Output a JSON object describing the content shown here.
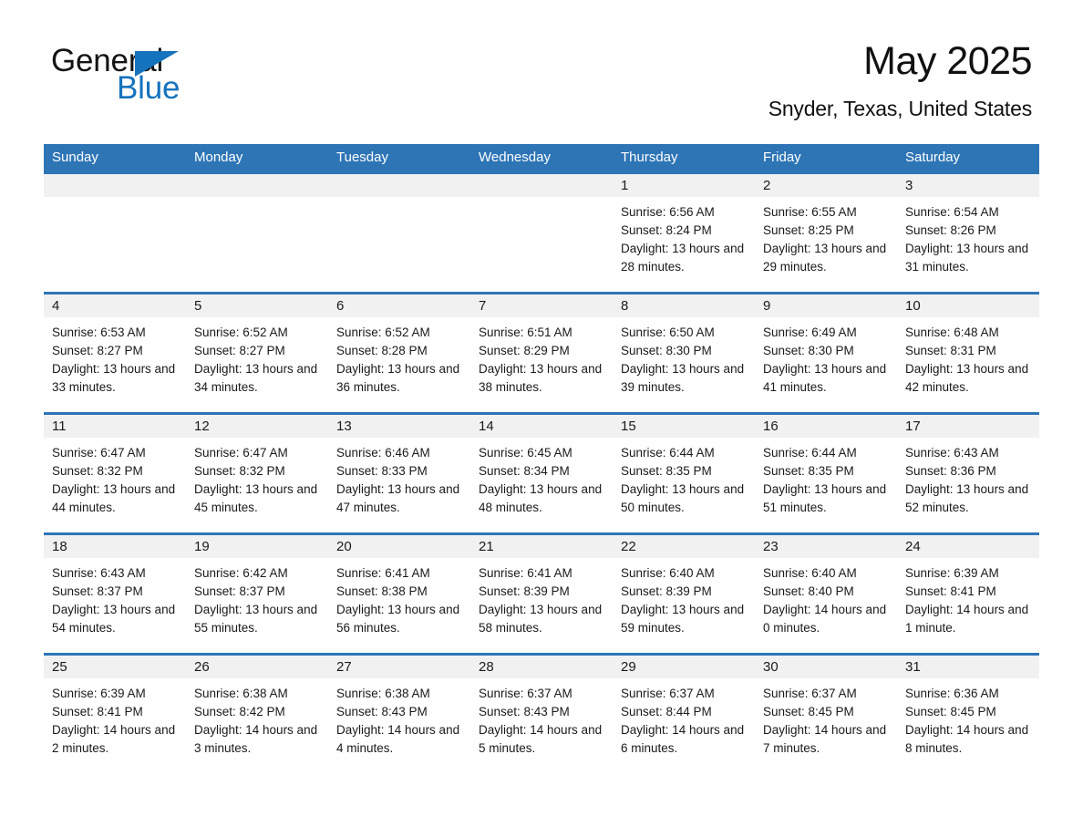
{
  "brand": {
    "name_part1": "General",
    "name_part2": "Blue",
    "triangle_color": "#1573bd",
    "logo_icon": "general-blue-triangle-logo"
  },
  "header": {
    "title": "May 2025",
    "subtitle": "Snyder, Texas, United States"
  },
  "colors": {
    "header_blue": "#2e75b6",
    "row_divider_blue": "#2e75b6",
    "daynum_band": "#f1f1f1",
    "text": "#1a1a1a",
    "page_background": "#ffffff"
  },
  "calendar": {
    "weekday_headers": [
      "Sunday",
      "Monday",
      "Tuesday",
      "Wednesday",
      "Thursday",
      "Friday",
      "Saturday"
    ],
    "weeks": [
      [
        {
          "day": "",
          "sunrise": "",
          "sunset": "",
          "daylight": ""
        },
        {
          "day": "",
          "sunrise": "",
          "sunset": "",
          "daylight": ""
        },
        {
          "day": "",
          "sunrise": "",
          "sunset": "",
          "daylight": ""
        },
        {
          "day": "",
          "sunrise": "",
          "sunset": "",
          "daylight": ""
        },
        {
          "day": "1",
          "sunrise": "Sunrise: 6:56 AM",
          "sunset": "Sunset: 8:24 PM",
          "daylight": "Daylight: 13 hours and 28 minutes."
        },
        {
          "day": "2",
          "sunrise": "Sunrise: 6:55 AM",
          "sunset": "Sunset: 8:25 PM",
          "daylight": "Daylight: 13 hours and 29 minutes."
        },
        {
          "day": "3",
          "sunrise": "Sunrise: 6:54 AM",
          "sunset": "Sunset: 8:26 PM",
          "daylight": "Daylight: 13 hours and 31 minutes."
        }
      ],
      [
        {
          "day": "4",
          "sunrise": "Sunrise: 6:53 AM",
          "sunset": "Sunset: 8:27 PM",
          "daylight": "Daylight: 13 hours and 33 minutes."
        },
        {
          "day": "5",
          "sunrise": "Sunrise: 6:52 AM",
          "sunset": "Sunset: 8:27 PM",
          "daylight": "Daylight: 13 hours and 34 minutes."
        },
        {
          "day": "6",
          "sunrise": "Sunrise: 6:52 AM",
          "sunset": "Sunset: 8:28 PM",
          "daylight": "Daylight: 13 hours and 36 minutes."
        },
        {
          "day": "7",
          "sunrise": "Sunrise: 6:51 AM",
          "sunset": "Sunset: 8:29 PM",
          "daylight": "Daylight: 13 hours and 38 minutes."
        },
        {
          "day": "8",
          "sunrise": "Sunrise: 6:50 AM",
          "sunset": "Sunset: 8:30 PM",
          "daylight": "Daylight: 13 hours and 39 minutes."
        },
        {
          "day": "9",
          "sunrise": "Sunrise: 6:49 AM",
          "sunset": "Sunset: 8:30 PM",
          "daylight": "Daylight: 13 hours and 41 minutes."
        },
        {
          "day": "10",
          "sunrise": "Sunrise: 6:48 AM",
          "sunset": "Sunset: 8:31 PM",
          "daylight": "Daylight: 13 hours and 42 minutes."
        }
      ],
      [
        {
          "day": "11",
          "sunrise": "Sunrise: 6:47 AM",
          "sunset": "Sunset: 8:32 PM",
          "daylight": "Daylight: 13 hours and 44 minutes."
        },
        {
          "day": "12",
          "sunrise": "Sunrise: 6:47 AM",
          "sunset": "Sunset: 8:32 PM",
          "daylight": "Daylight: 13 hours and 45 minutes."
        },
        {
          "day": "13",
          "sunrise": "Sunrise: 6:46 AM",
          "sunset": "Sunset: 8:33 PM",
          "daylight": "Daylight: 13 hours and 47 minutes."
        },
        {
          "day": "14",
          "sunrise": "Sunrise: 6:45 AM",
          "sunset": "Sunset: 8:34 PM",
          "daylight": "Daylight: 13 hours and 48 minutes."
        },
        {
          "day": "15",
          "sunrise": "Sunrise: 6:44 AM",
          "sunset": "Sunset: 8:35 PM",
          "daylight": "Daylight: 13 hours and 50 minutes."
        },
        {
          "day": "16",
          "sunrise": "Sunrise: 6:44 AM",
          "sunset": "Sunset: 8:35 PM",
          "daylight": "Daylight: 13 hours and 51 minutes."
        },
        {
          "day": "17",
          "sunrise": "Sunrise: 6:43 AM",
          "sunset": "Sunset: 8:36 PM",
          "daylight": "Daylight: 13 hours and 52 minutes."
        }
      ],
      [
        {
          "day": "18",
          "sunrise": "Sunrise: 6:43 AM",
          "sunset": "Sunset: 8:37 PM",
          "daylight": "Daylight: 13 hours and 54 minutes."
        },
        {
          "day": "19",
          "sunrise": "Sunrise: 6:42 AM",
          "sunset": "Sunset: 8:37 PM",
          "daylight": "Daylight: 13 hours and 55 minutes."
        },
        {
          "day": "20",
          "sunrise": "Sunrise: 6:41 AM",
          "sunset": "Sunset: 8:38 PM",
          "daylight": "Daylight: 13 hours and 56 minutes."
        },
        {
          "day": "21",
          "sunrise": "Sunrise: 6:41 AM",
          "sunset": "Sunset: 8:39 PM",
          "daylight": "Daylight: 13 hours and 58 minutes."
        },
        {
          "day": "22",
          "sunrise": "Sunrise: 6:40 AM",
          "sunset": "Sunset: 8:39 PM",
          "daylight": "Daylight: 13 hours and 59 minutes."
        },
        {
          "day": "23",
          "sunrise": "Sunrise: 6:40 AM",
          "sunset": "Sunset: 8:40 PM",
          "daylight": "Daylight: 14 hours and 0 minutes."
        },
        {
          "day": "24",
          "sunrise": "Sunrise: 6:39 AM",
          "sunset": "Sunset: 8:41 PM",
          "daylight": "Daylight: 14 hours and 1 minute."
        }
      ],
      [
        {
          "day": "25",
          "sunrise": "Sunrise: 6:39 AM",
          "sunset": "Sunset: 8:41 PM",
          "daylight": "Daylight: 14 hours and 2 minutes."
        },
        {
          "day": "26",
          "sunrise": "Sunrise: 6:38 AM",
          "sunset": "Sunset: 8:42 PM",
          "daylight": "Daylight: 14 hours and 3 minutes."
        },
        {
          "day": "27",
          "sunrise": "Sunrise: 6:38 AM",
          "sunset": "Sunset: 8:43 PM",
          "daylight": "Daylight: 14 hours and 4 minutes."
        },
        {
          "day": "28",
          "sunrise": "Sunrise: 6:37 AM",
          "sunset": "Sunset: 8:43 PM",
          "daylight": "Daylight: 14 hours and 5 minutes."
        },
        {
          "day": "29",
          "sunrise": "Sunrise: 6:37 AM",
          "sunset": "Sunset: 8:44 PM",
          "daylight": "Daylight: 14 hours and 6 minutes."
        },
        {
          "day": "30",
          "sunrise": "Sunrise: 6:37 AM",
          "sunset": "Sunset: 8:45 PM",
          "daylight": "Daylight: 14 hours and 7 minutes."
        },
        {
          "day": "31",
          "sunrise": "Sunrise: 6:36 AM",
          "sunset": "Sunset: 8:45 PM",
          "daylight": "Daylight: 14 hours and 8 minutes."
        }
      ]
    ]
  }
}
